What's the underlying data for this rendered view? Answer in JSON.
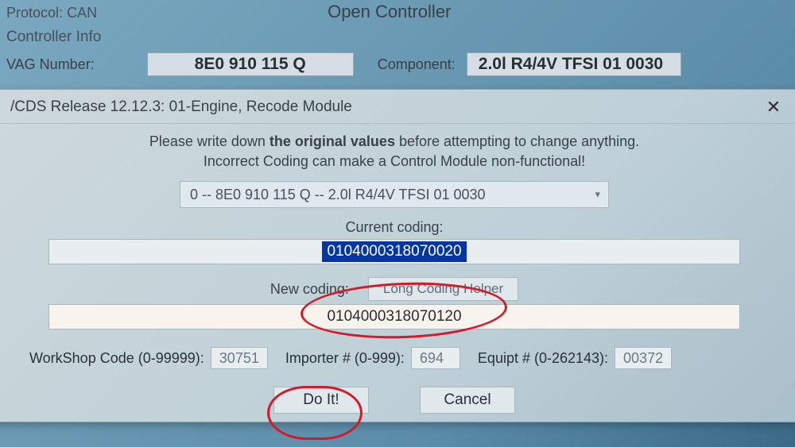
{
  "header": {
    "protocol_label": "Protocol:",
    "protocol_value": "CAN",
    "open_controller": "Open Controller",
    "controller_info": "Controller Info",
    "vag_number_label": "VAG Number:",
    "vag_number_value": "8E0 910 115 Q",
    "component_label": "Component:",
    "component_value": "2.0l R4/4V TFSI  01 0030"
  },
  "dialog": {
    "title": "/CDS Release 12.12.3: 01-Engine,  Recode Module",
    "close": "✕",
    "warning_line1_a": "Please write down ",
    "warning_line1_b": "the original values",
    "warning_line1_c": " before attempting to change anything.",
    "warning_line2": "Incorrect Coding can make a Control Module non-functional!",
    "dropdown_value": "0 -- 8E0 910 115 Q -- 2.0l R4/4V TFSI  01 0030",
    "current_coding_label": "Current coding:",
    "current_coding_value": "0104000318070020",
    "new_coding_label": "New coding:",
    "long_coding_helper": "Long Coding Helper",
    "new_coding_value": "0104000318070120",
    "workshop_label": "WorkShop Code (0-99999):",
    "workshop_value": "30751",
    "importer_label": "Importer # (0-999):",
    "importer_value": "694",
    "equipt_label": "Equipt # (0-262143):",
    "equipt_value": "00372",
    "do_it": "Do It!",
    "cancel": "Cancel"
  }
}
